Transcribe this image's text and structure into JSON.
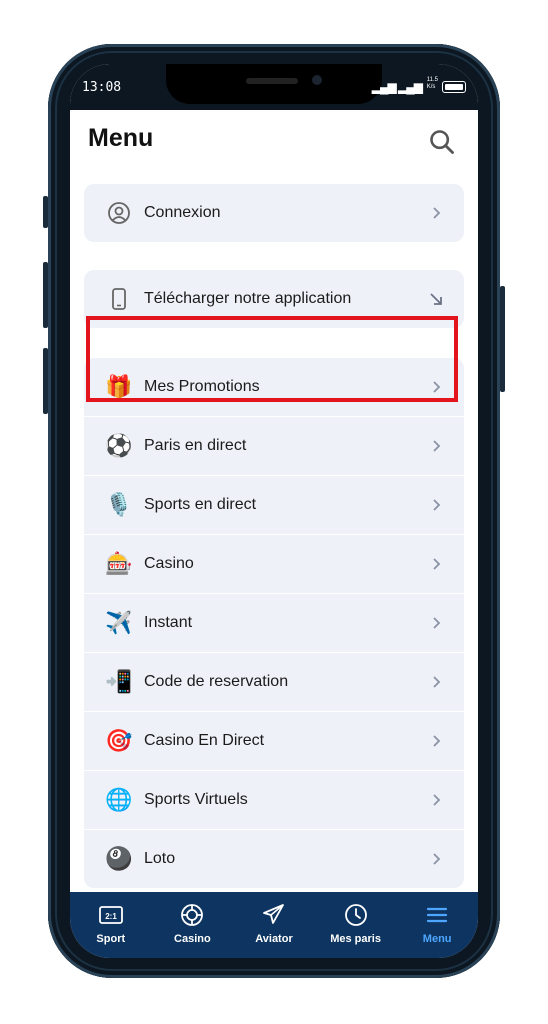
{
  "status": {
    "time": "13:08",
    "signal": "▂▄▆ ▂▄▆",
    "net_top": "11.5",
    "net_bottom": "K/s"
  },
  "header": {
    "title": "Menu"
  },
  "connexion": {
    "label": "Connexion"
  },
  "download": {
    "label": "Télécharger notre application"
  },
  "menu_items": [
    {
      "label": "Mes Promotions",
      "icon": "🎁"
    },
    {
      "label": "Paris en direct",
      "icon": "⚽"
    },
    {
      "label": "Sports en direct",
      "icon": "🎙️"
    },
    {
      "label": "Casino",
      "icon": "🎰"
    },
    {
      "label": "Instant",
      "icon": "✈️"
    },
    {
      "label": "Code de reservation",
      "icon": "📲"
    },
    {
      "label": "Casino En Direct",
      "icon": "🎯"
    },
    {
      "label": "Sports Virtuels",
      "icon": "🌐"
    },
    {
      "label": "Loto",
      "icon": "🎱"
    }
  ],
  "bottom_nav": [
    {
      "label": "Sport",
      "icon": "scoreboard-icon"
    },
    {
      "label": "Casino",
      "icon": "casino-chip-icon"
    },
    {
      "label": "Aviator",
      "icon": "plane-icon"
    },
    {
      "label": "Mes paris",
      "icon": "clock-icon"
    },
    {
      "label": "Menu",
      "icon": "hamburger-icon",
      "active": true
    }
  ],
  "colors": {
    "highlight": "#e4141c",
    "nav_bg": "#0e3561",
    "active": "#4da6ff",
    "card_bg": "#eef1f8"
  }
}
